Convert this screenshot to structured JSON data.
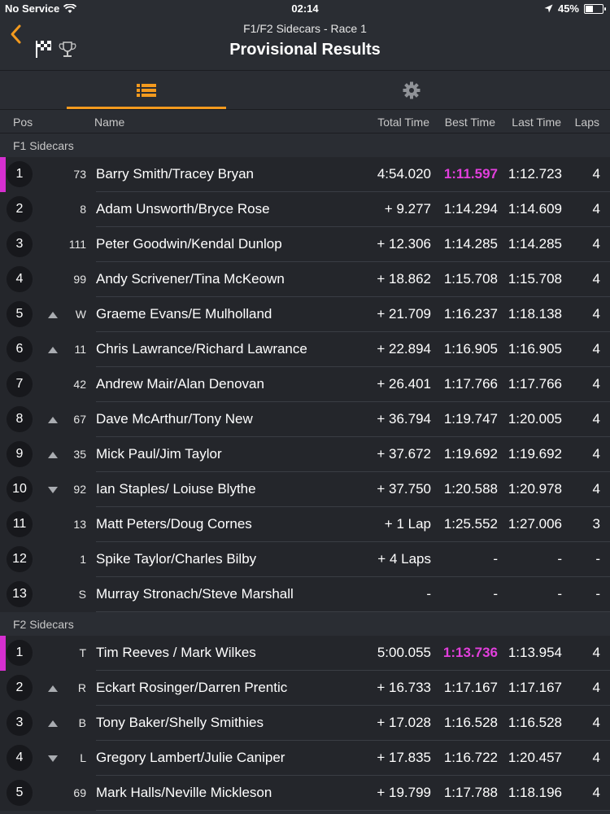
{
  "status_bar": {
    "carrier": "No Service",
    "time": "02:14",
    "battery": "45%"
  },
  "header": {
    "subtitle": "F1/F2 Sidecars - Race 1",
    "title": "Provisional Results"
  },
  "colors": {
    "accent": "#f39a1e",
    "fastest": "#e23fdc",
    "leader_bar": "#d62fd0"
  },
  "columns": {
    "pos": "Pos",
    "name": "Name",
    "total": "Total Time",
    "best": "Best Time",
    "last": "Last Time",
    "laps": "Laps"
  },
  "sections": [
    {
      "title": "F1 Sidecars",
      "rows": [
        {
          "pos": "1",
          "num": "73",
          "change": "",
          "name": "Barry Smith/Tracey Bryan",
          "total": "4:54.020",
          "best": "1:11.597",
          "last": "1:12.723",
          "laps": "4",
          "fastest": true,
          "leader": true
        },
        {
          "pos": "2",
          "num": "8",
          "change": "",
          "name": "Adam Unsworth/Bryce Rose",
          "total": "+ 9.277",
          "best": "1:14.294",
          "last": "1:14.609",
          "laps": "4"
        },
        {
          "pos": "3",
          "num": "111",
          "change": "",
          "name": "Peter Goodwin/Kendal Dunlop",
          "total": "+ 12.306",
          "best": "1:14.285",
          "last": "1:14.285",
          "laps": "4"
        },
        {
          "pos": "4",
          "num": "99",
          "change": "",
          "name": "Andy Scrivener/Tina McKeown",
          "total": "+ 18.862",
          "best": "1:15.708",
          "last": "1:15.708",
          "laps": "4"
        },
        {
          "pos": "5",
          "num": "W",
          "change": "up",
          "name": "Graeme Evans/E Mulholland",
          "total": "+ 21.709",
          "best": "1:16.237",
          "last": "1:18.138",
          "laps": "4"
        },
        {
          "pos": "6",
          "num": "11",
          "change": "up",
          "name": "Chris Lawrance/Richard Lawrance",
          "total": "+ 22.894",
          "best": "1:16.905",
          "last": "1:16.905",
          "laps": "4"
        },
        {
          "pos": "7",
          "num": "42",
          "change": "",
          "name": "Andrew Mair/Alan Denovan",
          "total": "+ 26.401",
          "best": "1:17.766",
          "last": "1:17.766",
          "laps": "4"
        },
        {
          "pos": "8",
          "num": "67",
          "change": "up",
          "name": "Dave McArthur/Tony New",
          "total": "+ 36.794",
          "best": "1:19.747",
          "last": "1:20.005",
          "laps": "4"
        },
        {
          "pos": "9",
          "num": "35",
          "change": "up",
          "name": "Mick Paul/Jim Taylor",
          "total": "+ 37.672",
          "best": "1:19.692",
          "last": "1:19.692",
          "laps": "4"
        },
        {
          "pos": "10",
          "num": "92",
          "change": "down",
          "name": "Ian Staples/ Loiuse Blythe",
          "total": "+ 37.750",
          "best": "1:20.588",
          "last": "1:20.978",
          "laps": "4"
        },
        {
          "pos": "11",
          "num": "13",
          "change": "",
          "name": "Matt Peters/Doug Cornes",
          "total": "+ 1 Lap",
          "best": "1:25.552",
          "last": "1:27.006",
          "laps": "3"
        },
        {
          "pos": "12",
          "num": "1",
          "change": "",
          "name": "Spike Taylor/Charles Bilby",
          "total": "+ 4 Laps",
          "best": "-",
          "last": "-",
          "laps": "-"
        },
        {
          "pos": "13",
          "num": "S",
          "change": "",
          "name": "Murray Stronach/Steve Marshall",
          "total": "-",
          "best": "-",
          "last": "-",
          "laps": "-"
        }
      ]
    },
    {
      "title": "F2 Sidecars",
      "rows": [
        {
          "pos": "1",
          "num": "T",
          "change": "",
          "name": "Tim Reeves / Mark Wilkes",
          "total": "5:00.055",
          "best": "1:13.736",
          "last": "1:13.954",
          "laps": "4",
          "fastest": true,
          "leader": true
        },
        {
          "pos": "2",
          "num": "R",
          "change": "up",
          "name": "Eckart Rosinger/Darren Prentic",
          "total": "+ 16.733",
          "best": "1:17.167",
          "last": "1:17.167",
          "laps": "4"
        },
        {
          "pos": "3",
          "num": "B",
          "change": "up",
          "name": "Tony Baker/Shelly Smithies",
          "total": "+ 17.028",
          "best": "1:16.528",
          "last": "1:16.528",
          "laps": "4"
        },
        {
          "pos": "4",
          "num": "L",
          "change": "down",
          "name": "Gregory Lambert/Julie Caniper",
          "total": "+ 17.835",
          "best": "1:16.722",
          "last": "1:20.457",
          "laps": "4"
        },
        {
          "pos": "5",
          "num": "69",
          "change": "",
          "name": "Mark Halls/Neville Mickleson",
          "total": "+ 19.799",
          "best": "1:17.788",
          "last": "1:18.196",
          "laps": "4"
        }
      ]
    }
  ]
}
